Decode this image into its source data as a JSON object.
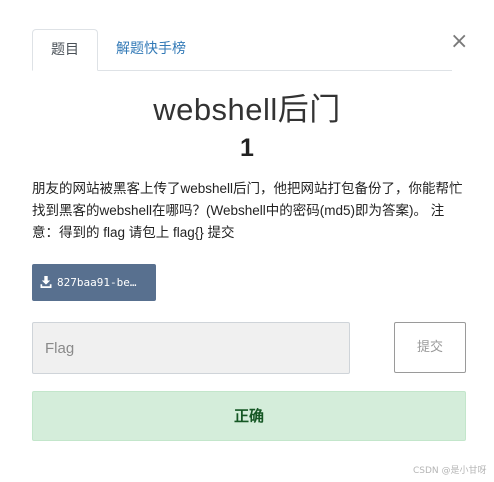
{
  "tabs": [
    {
      "label": "题目",
      "active": true
    },
    {
      "label": "解题快手榜",
      "active": false
    }
  ],
  "close_icon": "close-icon",
  "challenge": {
    "title": "webshell后门",
    "points": "1",
    "description": "朋友的网站被黑客上传了webshell后门，他把网站打包备份了，你能帮忙找到黑客的webshell在哪吗？(Webshell中的密码(md5)即为答案)。 注意：得到的 flag 请包上 flag{} 提交"
  },
  "file": {
    "label": "827baa91-be…",
    "icon": "download-icon",
    "color": "#58708f"
  },
  "flag_input": {
    "placeholder": "Flag",
    "value": ""
  },
  "submit_label": "提交",
  "result": {
    "text": "正确",
    "background": "#d4edda",
    "color": "#155724"
  },
  "watermark": "CSDN @是小甘呀"
}
